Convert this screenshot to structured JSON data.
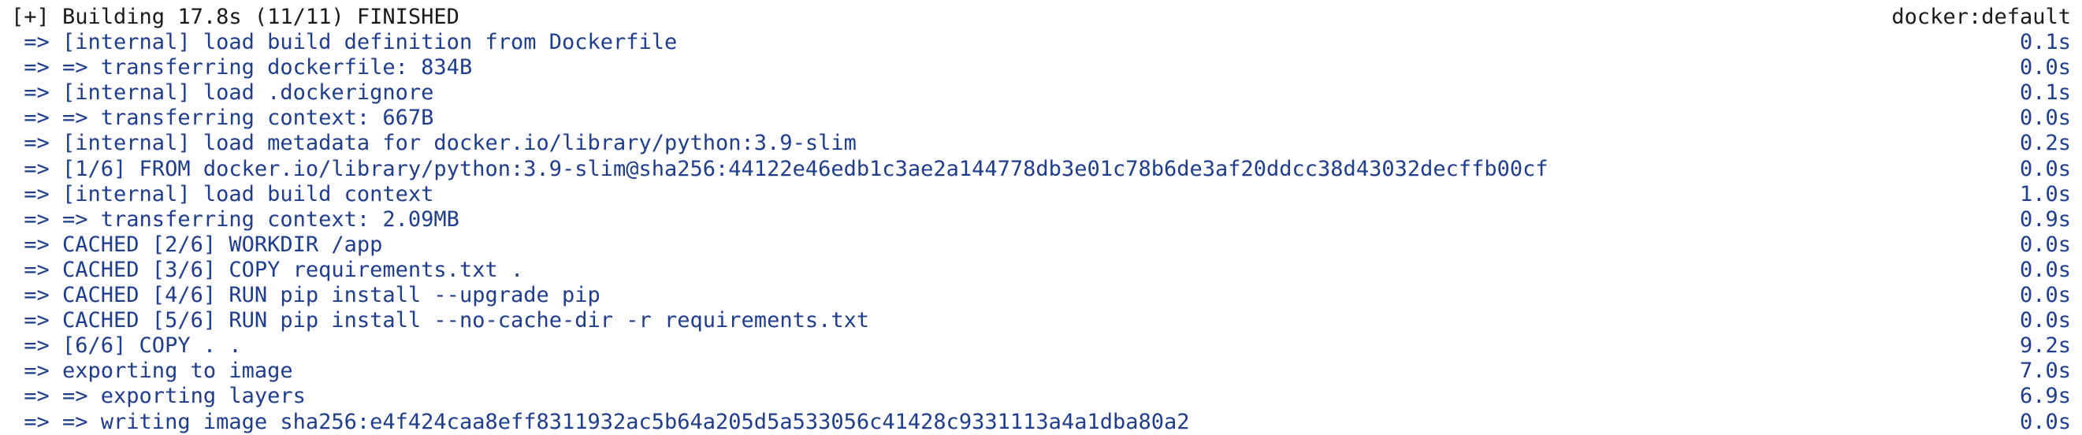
{
  "colors": {
    "background": "#ffffff",
    "header_text": "#1a1a1a",
    "step_text": "#1f3d8f"
  },
  "header": {
    "status": "[+] Building 17.8s (11/11) FINISHED",
    "builder": "docker:default"
  },
  "steps": [
    {
      "text": " => [internal] load build definition from Dockerfile",
      "duration": "0.1s"
    },
    {
      "text": " => => transferring dockerfile: 834B",
      "duration": "0.0s"
    },
    {
      "text": " => [internal] load .dockerignore",
      "duration": "0.1s"
    },
    {
      "text": " => => transferring context: 667B",
      "duration": "0.0s"
    },
    {
      "text": " => [internal] load metadata for docker.io/library/python:3.9-slim",
      "duration": "0.2s"
    },
    {
      "text": " => [1/6] FROM docker.io/library/python:3.9-slim@sha256:44122e46edb1c3ae2a144778db3e01c78b6de3af20ddcc38d43032decffb00cf",
      "duration": "0.0s"
    },
    {
      "text": " => [internal] load build context",
      "duration": "1.0s"
    },
    {
      "text": " => => transferring context: 2.09MB",
      "duration": "0.9s"
    },
    {
      "text": " => CACHED [2/6] WORKDIR /app",
      "duration": "0.0s"
    },
    {
      "text": " => CACHED [3/6] COPY requirements.txt .",
      "duration": "0.0s"
    },
    {
      "text": " => CACHED [4/6] RUN pip install --upgrade pip",
      "duration": "0.0s"
    },
    {
      "text": " => CACHED [5/6] RUN pip install --no-cache-dir -r requirements.txt",
      "duration": "0.0s"
    },
    {
      "text": " => [6/6] COPY . .",
      "duration": "9.2s"
    },
    {
      "text": " => exporting to image",
      "duration": "7.0s"
    },
    {
      "text": " => => exporting layers",
      "duration": "6.9s"
    },
    {
      "text": " => => writing image sha256:e4f424caa8eff8311932ac5b64a205d5a533056c41428c9331113a4a1dba80a2",
      "duration": "0.0s"
    }
  ]
}
